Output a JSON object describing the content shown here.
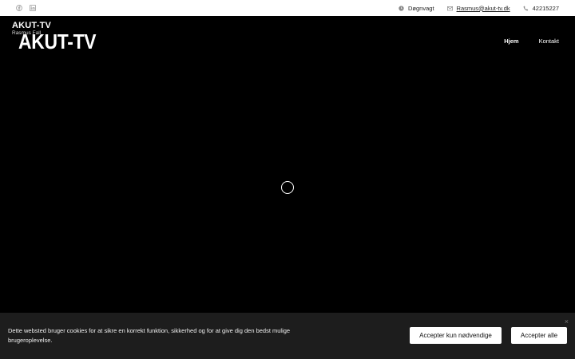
{
  "topbar": {
    "social": [
      {
        "icon": "facebook-icon"
      },
      {
        "icon": "linkedin-icon"
      }
    ],
    "hours_label": "Døgnvagt",
    "email": "Rasmus@akut-tv.dk",
    "phone": "42215227"
  },
  "brand": {
    "title_small": "AKUT-TV",
    "subtitle": "Rasmus Fall",
    "title_big": "AKUT-TV"
  },
  "nav": {
    "items": [
      {
        "label": "Hjem",
        "active": true
      },
      {
        "label": "Kontakt",
        "active": false
      }
    ]
  },
  "cookie": {
    "text": "Dette websted bruger cookies for at sikre en korrekt funktion, sikkerhed og for at give dig den bedst mulige brugeroplevelse.",
    "accept_necessary": "Accepter kun nødvendige",
    "accept_all": "Accepter alle",
    "close_symbol": "×"
  }
}
